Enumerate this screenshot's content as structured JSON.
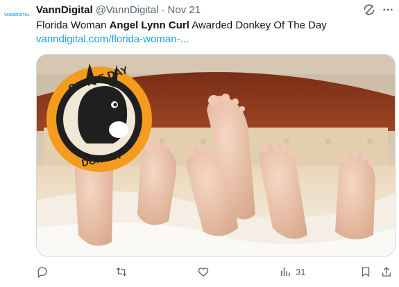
{
  "tweet": {
    "avatar_text": "VANNDIGITAL",
    "author_name": "VannDigital",
    "author_handle": "@VannDigital",
    "separator": "·",
    "timestamp": "Nov 21",
    "text_before": "Florida Woman ",
    "text_bold": "Angel Lynn Curl",
    "text_after": " Awarded Donkey Of The Day",
    "link": "vanndigital.com/florida-woman-...",
    "badge_top": "OF THE DAY",
    "badge_bottom": "DONKEY",
    "views_count": "31"
  },
  "icons": {
    "grok": "grok-icon",
    "more": "more-icon",
    "reply": "reply-icon",
    "retweet": "retweet-icon",
    "like": "like-icon",
    "views": "views-icon",
    "bookmark": "bookmark-icon",
    "share": "share-icon"
  },
  "colors": {
    "link": "#1d9bf0",
    "muted": "#536471",
    "badge": "#f39c1d"
  }
}
